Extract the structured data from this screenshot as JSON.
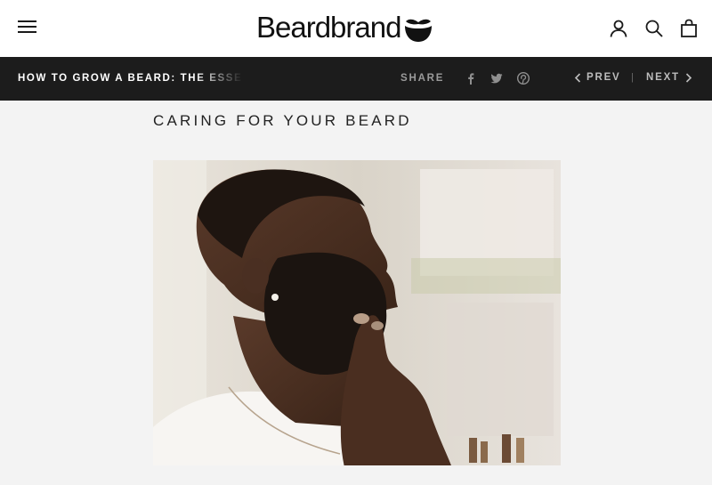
{
  "header": {
    "brand": "Beardbrand",
    "icons": [
      "menu-icon",
      "beard-logo-icon",
      "account-icon",
      "search-icon",
      "cart-icon"
    ]
  },
  "article_bar": {
    "title": "HOW TO GROW A BEARD: THE ESSENTIALS",
    "share_label": "SHARE",
    "social_icons": [
      "facebook-icon",
      "twitter-icon",
      "pinterest-icon"
    ],
    "prev_label": "PREV",
    "separator": "|",
    "next_label": "NEXT"
  },
  "content": {
    "section_title": "CARING FOR YOUR BEARD",
    "image_alt": "Man touching his full beard in profile"
  },
  "colors": {
    "page_bg": "#f3f3f3",
    "header_bg": "#ffffff",
    "bar_bg": "#1c1c1c",
    "bar_text": "#ffffff",
    "muted_text": "#9a9a9a"
  }
}
